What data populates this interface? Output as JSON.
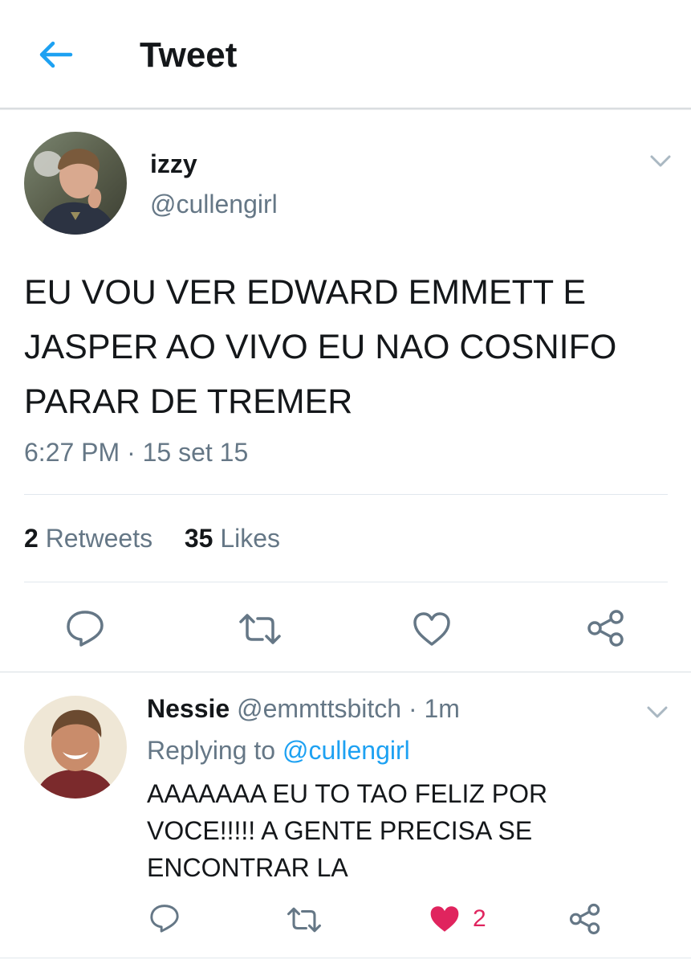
{
  "header": {
    "title": "Tweet"
  },
  "tweet": {
    "author_name": "izzy",
    "author_handle": "@cullengirl",
    "text": "EU VOU VER EDWARD EMMETT E JASPER AO VIVO EU NAO COSNIFO PARAR DE TREMER",
    "time": "6:27 PM",
    "separator": "·",
    "date": "15 set 15",
    "retweets_count": "2",
    "retweets_label": "Retweets",
    "likes_count": "35",
    "likes_label": "Likes"
  },
  "reply": {
    "author_name": "Nessie",
    "author_handle": "@emmttsbitch",
    "separator": "·",
    "age": "1m",
    "replying_prefix": "Replying to",
    "replying_handle": "@cullengirl",
    "text": "AAAAAAA EU TO TAO FELIZ POR VOCE!!!!! A GENTE PRECISA SE ENCONTRAR LA",
    "like_count": "2"
  },
  "icons": {
    "back": "arrow-left-icon",
    "menu": "chevron-down-icon",
    "reply": "reply-icon",
    "retweet": "retweet-icon",
    "like": "heart-icon",
    "share": "share-icon"
  },
  "colors": {
    "accent": "#1da1f2",
    "muted": "#657786",
    "text": "#14171a",
    "like_active": "#e0245e",
    "divider": "#e1e8ed"
  }
}
